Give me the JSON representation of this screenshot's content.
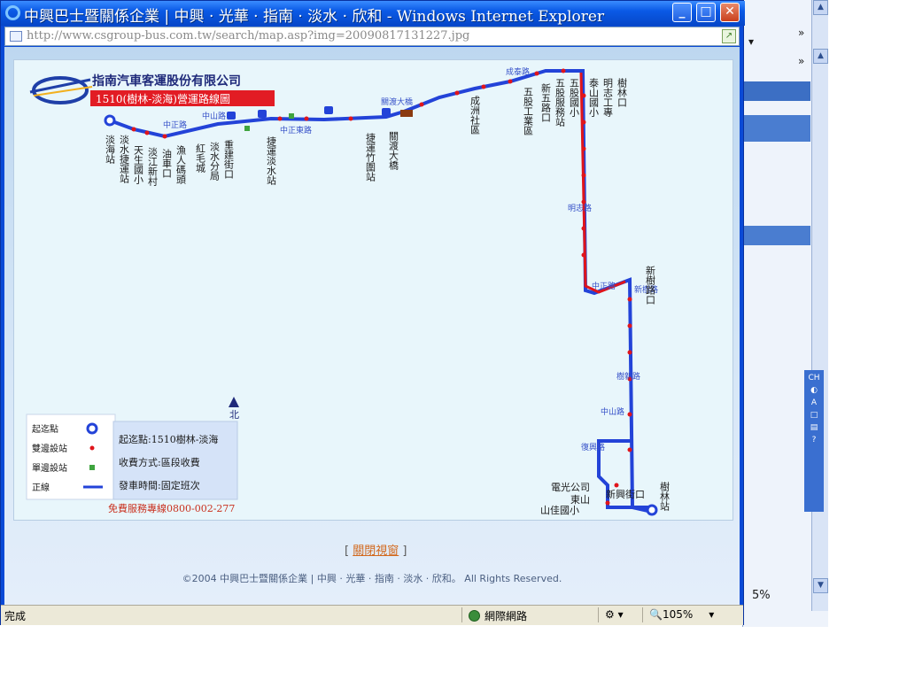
{
  "window": {
    "title": "中興巴士暨關係企業 | 中興 · 光華 · 指南 · 淡水 · 欣和 - Windows Internet Explorer",
    "url": "http://www.csgroup-bus.com.tw/search/map.asp?img=20090817131227.jpg"
  },
  "map": {
    "company": "指南汽車客運股份有限公司",
    "route_title": "1510(樹林-淡海)營運路線圖",
    "roads": [
      "中正路",
      "中山路",
      "中正東路",
      "關渡大橋",
      "成泰路",
      "明志路",
      "中正路",
      "新樹路",
      "樹新路",
      "中山路",
      "復興路"
    ],
    "north_label": "北",
    "legend": [
      {
        "label": "起迄點",
        "symbol": "terminal"
      },
      {
        "label": "雙邊設站",
        "symbol": "red-dot"
      },
      {
        "label": "單邊設站",
        "symbol": "green-square"
      },
      {
        "label": "正線",
        "symbol": "blue-line"
      }
    ],
    "info": [
      "起迄點:1510樹林-淡海",
      "收費方式:區段收費",
      "發車時間:固定班次"
    ],
    "hotline": "免費服務專線0800-002-277",
    "stations_top": [
      "淡海站",
      "淡水捷運站",
      "天生國小",
      "淡江新村",
      "油車口",
      "漁人碼頭",
      "紅毛城",
      "淡水分局",
      "重建街口",
      "捷運淡水站",
      "捷運竹圍站",
      "關渡大橋"
    ],
    "stations_right": [
      "五股國小",
      "五股服務站",
      "新五路口",
      "五股工業區",
      "成洲社區",
      "泰山國小",
      "明志工專",
      "樹林口",
      "新樹路口",
      "樹林站"
    ],
    "stations_bottom": [
      "電光公司",
      "東山",
      "山佳國小",
      "新興街口",
      "樹林站"
    ]
  },
  "page": {
    "close_link_left": "[",
    "close_link": "關閉視窗",
    "close_link_right": "]",
    "footer": "©2004 中興巴士暨關係企業 | 中興 · 光華 · 指南 · 淡水 · 欣和。 All Rights Reserved."
  },
  "statusbar": {
    "status": "完成",
    "zone": "網際網路",
    "zoom": "105%"
  },
  "background": {
    "zoom_partial": "5%"
  },
  "colors": {
    "route_blue": "#2343d8",
    "route_red": "#e0151b",
    "stop_green": "#3fa43f",
    "title_red": "#e21c24"
  }
}
